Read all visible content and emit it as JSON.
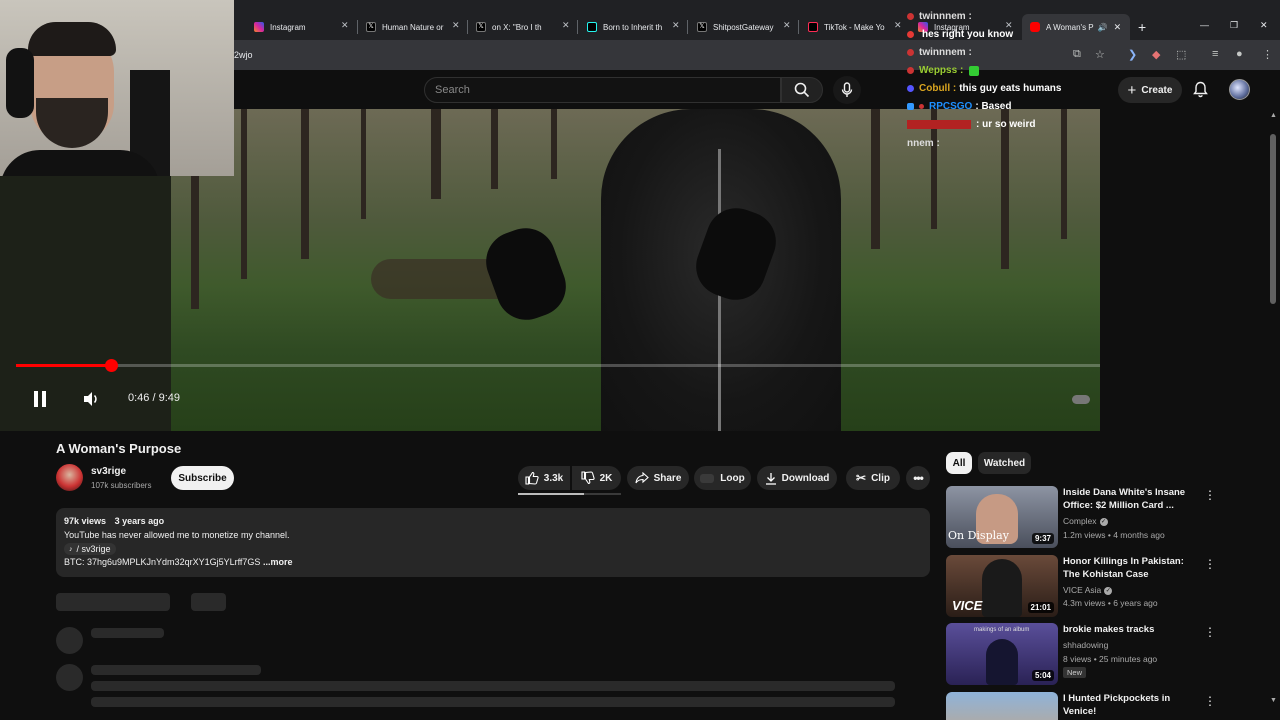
{
  "browser": {
    "tabs": [
      {
        "label": "Instagram",
        "color": "#d6249f"
      },
      {
        "label": "Human Nature or",
        "color": "#000000"
      },
      {
        "label": "on X: \"Bro I th",
        "color": "#000000"
      },
      {
        "label": "Born to Inherit th",
        "color": "#010101"
      },
      {
        "label": "ShitpostGateway",
        "color": "#000000"
      },
      {
        "label": "TikTok - Make Yo",
        "color": "#010101"
      },
      {
        "label": "Instagram",
        "color": "#d6249f"
      },
      {
        "label": "A Woman's P",
        "color": "#ff0000"
      }
    ],
    "url_fragment": "2wjo"
  },
  "masthead": {
    "search_placeholder": "Search",
    "create_label": "Create"
  },
  "player": {
    "time": "0:46 / 9:49",
    "progress_fraction": 0.078,
    "hd_badge": "HD"
  },
  "chat": [
    {
      "user": "twinnnem :",
      "msg": "",
      "color": "#dddddd"
    },
    {
      "user": "",
      "msg": "hes right you know",
      "color": "#e53935"
    },
    {
      "user": "twinnnem :",
      "msg": "",
      "color": "#dddddd"
    },
    {
      "user": "Weppss :",
      "msg": "",
      "color": "#9acd32"
    },
    {
      "user": "Cobull :",
      "msg": "this guy eats humans",
      "color": "#daa520"
    },
    {
      "user": "RPCSGO",
      "msg": ": Based",
      "color": "#1e90ff"
    },
    {
      "user": "",
      "msg": ": ur so weird",
      "color": "#b22222"
    },
    {
      "user": "nnem :",
      "msg": "",
      "color": "#dddddd"
    }
  ],
  "video": {
    "title": "A Woman's Purpose",
    "channel": "sv3rige",
    "subscribers": "107k subscribers",
    "subscribe_label": "Subscribe",
    "likes": "3.3k",
    "dislikes": "2K",
    "share_label": "Share",
    "loop_label": "Loop",
    "download_label": "Download",
    "clip_label": "Clip"
  },
  "description": {
    "views": "97k views",
    "age": "3 years ago",
    "line1": "YouTube has never allowed me to monetize my channel.",
    "tag": "/ sv3rige",
    "btc": "BTC: 37hg6u9MPLKJnYdm32qrXY1Gj5YLrff7GS",
    "more": "...more"
  },
  "sidebar": {
    "chips": [
      "All",
      "Watched"
    ],
    "recommendations": [
      {
        "title": "Inside Dana White's Insane Office: $2 Million Card ...",
        "channel": "Complex",
        "verified": true,
        "meta": "1.2m views • 4 months ago",
        "duration": "9:37",
        "thumb_text": "On Display",
        "new": ""
      },
      {
        "title": "Honor Killings In Pakistan: The Kohistan Case",
        "channel": "VICE Asia",
        "verified": true,
        "meta": "4.3m views • 6 years ago",
        "duration": "21:01",
        "thumb_text": "VICE",
        "new": ""
      },
      {
        "title": "brokie makes tracks",
        "channel": "shhadowing",
        "verified": false,
        "meta": "8 views • 25 minutes ago",
        "duration": "5:04",
        "thumb_text": "makings of an album",
        "new": "New"
      },
      {
        "title": "I Hunted Pickpockets in Venice!",
        "channel": "",
        "verified": false,
        "meta": "",
        "duration": "",
        "thumb_text": "",
        "new": ""
      }
    ]
  }
}
